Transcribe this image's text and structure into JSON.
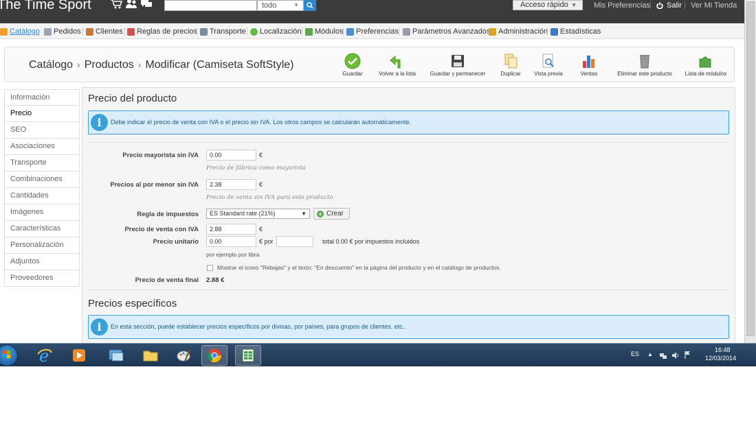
{
  "header": {
    "shop_name": "The Time Sport",
    "search_scope": "todo",
    "quick_access": "Acceso rápido",
    "links": [
      "Mis Preferencias",
      "Salir",
      "Ver Mi Tienda"
    ]
  },
  "menu": {
    "items": [
      {
        "label": "Catálogo",
        "icon": "catalog-icon",
        "color": "#f0a030"
      },
      {
        "label": "Pedidos",
        "icon": "cart-icon",
        "color": "#9aa6b4"
      },
      {
        "label": "Clientes",
        "icon": "customers-icon",
        "color": "#c87a3a"
      },
      {
        "label": "Reglas de precios",
        "icon": "price-rules-icon",
        "color": "#d35050"
      },
      {
        "label": "Transporte",
        "icon": "truck-icon",
        "color": "#7a8aa0"
      },
      {
        "label": "Localización",
        "icon": "globe-icon",
        "color": "#6cb844"
      },
      {
        "label": "Módulos",
        "icon": "puzzle-icon",
        "color": "#5ba84a"
      },
      {
        "label": "Preferencias",
        "icon": "preferences-icon",
        "color": "#4a90d0"
      },
      {
        "label": "Parámetros Avanzados",
        "icon": "wrench-icon",
        "color": "#9a9aa8"
      },
      {
        "label": "Administración",
        "icon": "key-icon",
        "color": "#e0a020"
      },
      {
        "label": "Estadísticas",
        "icon": "stats-icon",
        "color": "#3a7ac8"
      }
    ]
  },
  "breadcrumb": [
    "Catálogo",
    "Productos",
    "Modificar (Camiseta SoftStyle)"
  ],
  "toolbar": {
    "buttons": [
      {
        "label": "Guardar",
        "icon": "check-icon"
      },
      {
        "label": "Volver a la lista",
        "icon": "back-arrow-icon"
      },
      {
        "label": "Guardar y permanecer",
        "icon": "floppy-icon"
      },
      {
        "label": "Duplicar",
        "icon": "duplicate-icon"
      },
      {
        "label": "Vista previa",
        "icon": "preview-icon"
      },
      {
        "label": "Ventas",
        "icon": "sales-chart-icon"
      },
      {
        "label": "Eliminar este producto",
        "icon": "trash-icon"
      },
      {
        "label": "Lista de módulos",
        "icon": "puzzle-icon"
      }
    ]
  },
  "sidebar": {
    "items": [
      "Información",
      "Precio",
      "SEO",
      "Asociaciones",
      "Transporte",
      "Combinaciones",
      "Cantidades",
      "Imágenes",
      "Características",
      "Personalización",
      "Adjuntos",
      "Proveedores"
    ],
    "active": "Precio"
  },
  "price_section": {
    "title": "Precio del producto",
    "info": "Debe indicar el precio de venta con IVA o el precio sin IVA. Los otros campos se calcularán automáticamente.",
    "wholesale": {
      "label": "Precio mayorista sin IVA",
      "value": "0.00",
      "unit": "€",
      "help": "Precio de fábrica como mayorista"
    },
    "retail": {
      "label": "Precios al por menor sin IVA",
      "value": "2.38",
      "unit": "€",
      "help": "Precio de venta sin IVA para este producto"
    },
    "tax_rule": {
      "label": "Regla de impuestos",
      "value": "ES Standard rate (21%)",
      "create_label": "Crear"
    },
    "price_with_tax": {
      "label": "Precio de venta con IVA",
      "value": "2.88",
      "unit": "€"
    },
    "unit_price": {
      "label": "Precio unitario",
      "value": "0.00",
      "unit": "€ por",
      "per_value": "",
      "total_text": "total 0.00 € por impuestos incluidos",
      "help": "por ejemplo por libra"
    },
    "discount_checkbox": "Mostrar el icono \"Rebajas\" y el texto: \"En descuento\" en la página del producto y en el catálogo de productos.",
    "final_price": {
      "label": "Precio de venta final",
      "value": "2.88 €"
    }
  },
  "specific_section": {
    "title": "Precios específicos",
    "info": "En esta sección, puede establecer precios específicos por divisas, por países, para grupos de clientes, etc.."
  },
  "taskbar": {
    "language": "ES",
    "time": "16:48",
    "date": "12/03/2014"
  }
}
